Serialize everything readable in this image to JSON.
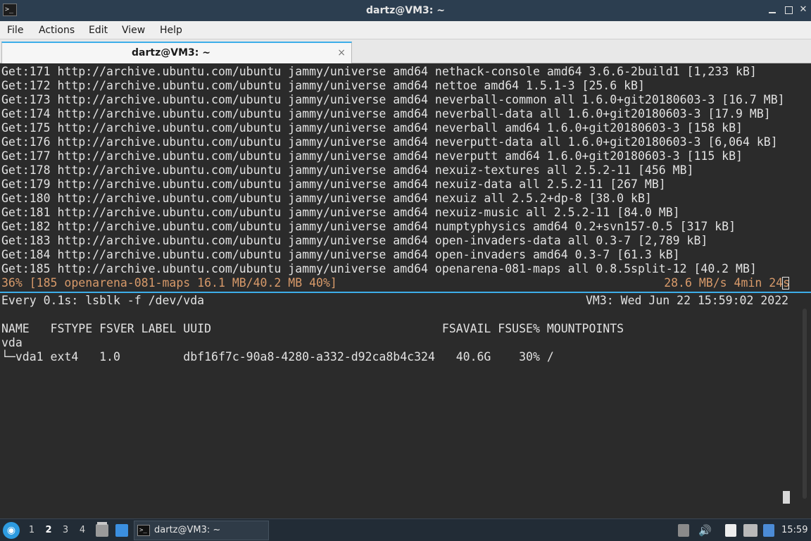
{
  "window": {
    "title": "dartz@VM3: ~",
    "app_icon": "terminal-icon",
    "controls": [
      "minimize-icon",
      "maximize-icon",
      "close-icon"
    ]
  },
  "menu": [
    "File",
    "Actions",
    "Edit",
    "View",
    "Help"
  ],
  "tab": {
    "title": "dartz@VM3: ~",
    "close_glyph": "×"
  },
  "top_pane": {
    "lines": [
      "Get:171 http://archive.ubuntu.com/ubuntu jammy/universe amd64 nethack-console amd64 3.6.6-2build1 [1,233 kB]",
      "Get:172 http://archive.ubuntu.com/ubuntu jammy/universe amd64 nettoe amd64 1.5.1-3 [25.6 kB]",
      "Get:173 http://archive.ubuntu.com/ubuntu jammy/universe amd64 neverball-common all 1.6.0+git20180603-3 [16.7 MB]",
      "Get:174 http://archive.ubuntu.com/ubuntu jammy/universe amd64 neverball-data all 1.6.0+git20180603-3 [17.9 MB]",
      "Get:175 http://archive.ubuntu.com/ubuntu jammy/universe amd64 neverball amd64 1.6.0+git20180603-3 [158 kB]",
      "Get:176 http://archive.ubuntu.com/ubuntu jammy/universe amd64 neverputt-data all 1.6.0+git20180603-3 [6,064 kB]",
      "Get:177 http://archive.ubuntu.com/ubuntu jammy/universe amd64 neverputt amd64 1.6.0+git20180603-3 [115 kB]",
      "Get:178 http://archive.ubuntu.com/ubuntu jammy/universe amd64 nexuiz-textures all 2.5.2-11 [456 MB]",
      "Get:179 http://archive.ubuntu.com/ubuntu jammy/universe amd64 nexuiz-data all 2.5.2-11 [267 MB]",
      "Get:180 http://archive.ubuntu.com/ubuntu jammy/universe amd64 nexuiz all 2.5.2+dp-8 [38.0 kB]",
      "Get:181 http://archive.ubuntu.com/ubuntu jammy/universe amd64 nexuiz-music all 2.5.2-11 [84.0 MB]",
      "Get:182 http://archive.ubuntu.com/ubuntu jammy/universe amd64 numptyphysics amd64 0.2+svn157-0.5 [317 kB]",
      "Get:183 http://archive.ubuntu.com/ubuntu jammy/universe amd64 open-invaders-data all 0.3-7 [2,789 kB]",
      "Get:184 http://archive.ubuntu.com/ubuntu jammy/universe amd64 open-invaders amd64 0.3-7 [61.3 kB]",
      "Get:185 http://archive.ubuntu.com/ubuntu jammy/universe amd64 openarena-081-maps all 0.8.5split-12 [40.2 MB]"
    ],
    "progress_left": "36% [185 openarena-081-maps 16.1 MB/40.2 MB 40%]",
    "progress_right": "28.6 MB/s 4min 24s",
    "progress_color": "#d89a6a"
  },
  "bottom_pane": {
    "header_left": "Every 0.1s: lsblk -f /dev/vda",
    "header_right": "VM3: Wed Jun 22 15:59:02 2022",
    "table_header": "NAME   FSTYPE FSVER LABEL UUID                                 FSAVAIL FSUSE% MOUNTPOINTS",
    "rows": [
      "vda",
      "└─vda1 ext4   1.0         dbf16f7c-90a8-4280-a332-d92ca8b4c324   40.6G    30% /"
    ]
  },
  "taskbar": {
    "start_icon": "menu-icon",
    "workspaces": [
      "1",
      "2",
      "3",
      "4"
    ],
    "active_workspace": "2",
    "task_label": "dartz@VM3: ~",
    "clock": "15:59",
    "tray_icons": [
      "clipboard-icon",
      "volume-icon",
      "notes-icon",
      "network-icon",
      "notification-icon"
    ]
  },
  "colors": {
    "titlebar_bg": "#2c3e50",
    "terminal_bg": "#2b2b2b",
    "accent": "#3daee9",
    "taskbar_bg": "#222c36"
  }
}
